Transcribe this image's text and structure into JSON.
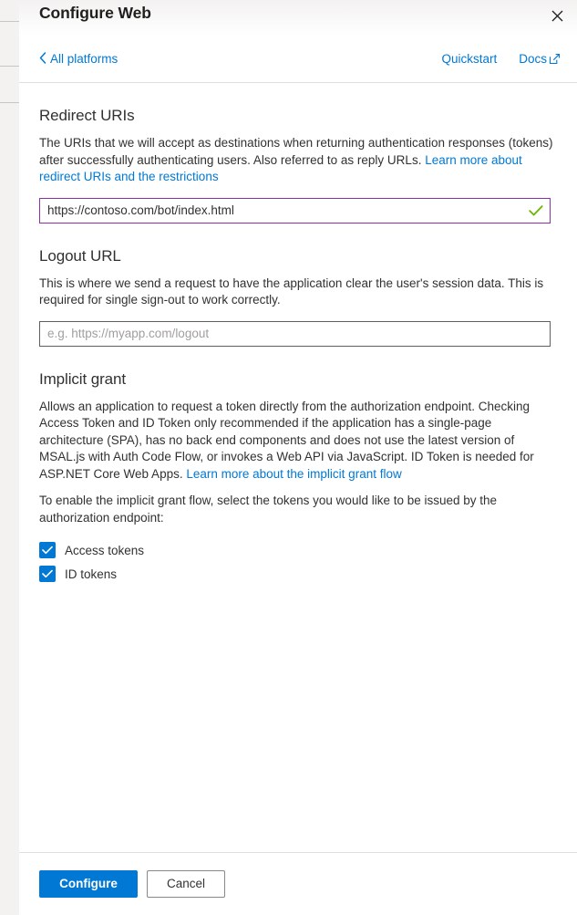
{
  "background": {
    "rule_count": 3
  },
  "dialog": {
    "title": "Configure Web",
    "close_icon": "close-icon",
    "command_bar": {
      "back_chevron": "‹",
      "back_label": "All platforms",
      "quickstart_label": "Quickstart",
      "docs_label": "Docs",
      "docs_external_icon": "external-link-icon"
    },
    "sections": [
      {
        "id": "redirect-uris",
        "title": "Redirect URIs",
        "description_parts": [
          {
            "type": "text",
            "text": "The URIs that we will accept as destinations when returning authentication responses (tokens) after successfully authenticating users. Also referred to as reply URLs. "
          },
          {
            "type": "link",
            "text": "Learn more about redirect URIs and the restrictions"
          }
        ],
        "input": {
          "name": "redirect-uri-input",
          "value": "https://contoso.com/bot/index.html",
          "placeholder": "",
          "state": "valid",
          "border_color": "#8f2fb0",
          "check_icon": "checkmark-icon",
          "check_color": "#6bb700"
        }
      },
      {
        "id": "logout-url",
        "title": "Logout URL",
        "description_parts": [
          {
            "type": "text",
            "text": "This is where we send a request to have the application clear the user's session data. This is required for single sign-out to work correctly."
          }
        ],
        "input": {
          "name": "logout-url-input",
          "value": "",
          "placeholder": "e.g. https://myapp.com/logout",
          "state": "empty",
          "border_color": "#605e5c"
        }
      },
      {
        "id": "implicit-grant",
        "title": "Implicit grant",
        "description_parts": [
          {
            "type": "text",
            "text": "Allows an application to request a token directly from the authorization endpoint. Checking Access Token and ID Token only recommended if the application has a single-page architecture (SPA), has no back end components and does not use the latest version of MSAL.js with Auth Code Flow, or invokes a Web API via JavaScript. ID Token is needed for ASP.NET Core Web Apps. "
          },
          {
            "type": "link",
            "text": "Learn more about the implicit grant flow"
          }
        ],
        "secondary_description": "To enable the implicit grant flow, select the tokens you would like to be issued by the authorization endpoint:",
        "checkboxes": [
          {
            "name": "access-tokens-checkbox",
            "label": "Access tokens",
            "checked": true
          },
          {
            "name": "id-tokens-checkbox",
            "label": "ID tokens",
            "checked": true
          }
        ]
      }
    ],
    "footer": {
      "primary_label": "Configure",
      "secondary_label": "Cancel"
    }
  },
  "colors": {
    "accent": "#0078d4",
    "valid_border": "#8f2fb0",
    "valid_check": "#6bb700",
    "text": "#323130",
    "divider": "#e1dfdd"
  }
}
